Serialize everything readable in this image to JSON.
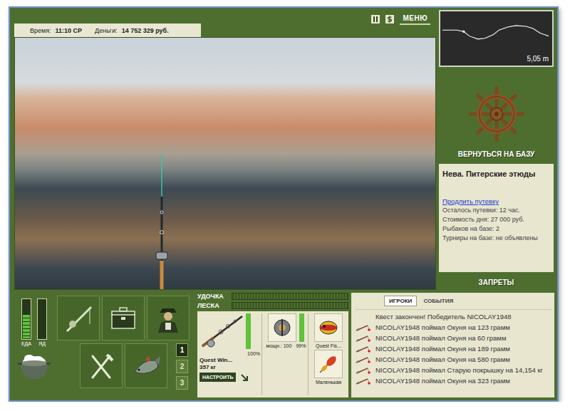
{
  "status": {
    "time_label": "Время:",
    "time": "11:10 СР",
    "money_label": "Деньги:",
    "money": "14 752 329 руб."
  },
  "menu_button": "МЕНЮ",
  "depth_map": {
    "reading": "5,05 m"
  },
  "return_button": "ВЕРНУТЬСЯ НА БАЗУ",
  "location": {
    "title": "Нева. Питерские этюды",
    "extend_link": "Продлить путевку",
    "details": [
      "Осталось путевки: 12 час.",
      "Стоимость дня: 27 000 руб.",
      "Рыбаков на базе: 2",
      "Турниры на базе: не объявлены"
    ]
  },
  "bans_button": "ЗАПРЕТЫ",
  "meters": [
    {
      "label": "ЕДА",
      "level": 0.62,
      "color": "#5fc23a"
    },
    {
      "label": "ЯД",
      "level": 0,
      "color": "#c23a3a"
    }
  ],
  "slots": [
    {
      "label": "1",
      "selected": true
    },
    {
      "label": "2",
      "selected": false
    },
    {
      "label": "3",
      "selected": false
    }
  ],
  "tension": [
    {
      "label": "УДОЧКА",
      "level": 0
    },
    {
      "label": "ЛЕСКА",
      "level": 0
    }
  ],
  "tackle": {
    "rod": {
      "name": "Quest Win...",
      "capacity": "357 кг",
      "durability": "100%",
      "level": 1
    },
    "reel": {
      "power": "мощн.: 100",
      "durability": "99%",
      "level": 0.99
    },
    "bait": {
      "name": "Quest Fis..."
    },
    "lure": {
      "name": "Маленькая"
    },
    "setup_button": "НАСТРОИТЬ"
  },
  "feed": {
    "tabs": [
      {
        "label": "ИГРОКИ",
        "selected": true
      },
      {
        "label": "СОБЫТИЯ",
        "selected": false
      }
    ],
    "messages": [
      {
        "text": "Квест закончен! Победитель NICOLAY1948",
        "kind": "notice"
      },
      {
        "text": "NICOLAY1948 поймал Окуня на 123 грамм",
        "kind": "catch"
      },
      {
        "text": "NICOLAY1948 поймал Окуня на 60 грамм",
        "kind": "catch"
      },
      {
        "text": "NICOLAY1948 поймал Окуня на 189 грамм",
        "kind": "catch"
      },
      {
        "text": "NICOLAY1948 поймал Окуня на 580 грамм",
        "kind": "catch"
      },
      {
        "text": "NICOLAY1948 поймал Старую покрышку на 14,154 кг",
        "kind": "catch"
      },
      {
        "text": "NICOLAY1948 поймал Окуня на 323 грамм",
        "kind": "catch"
      }
    ]
  }
}
